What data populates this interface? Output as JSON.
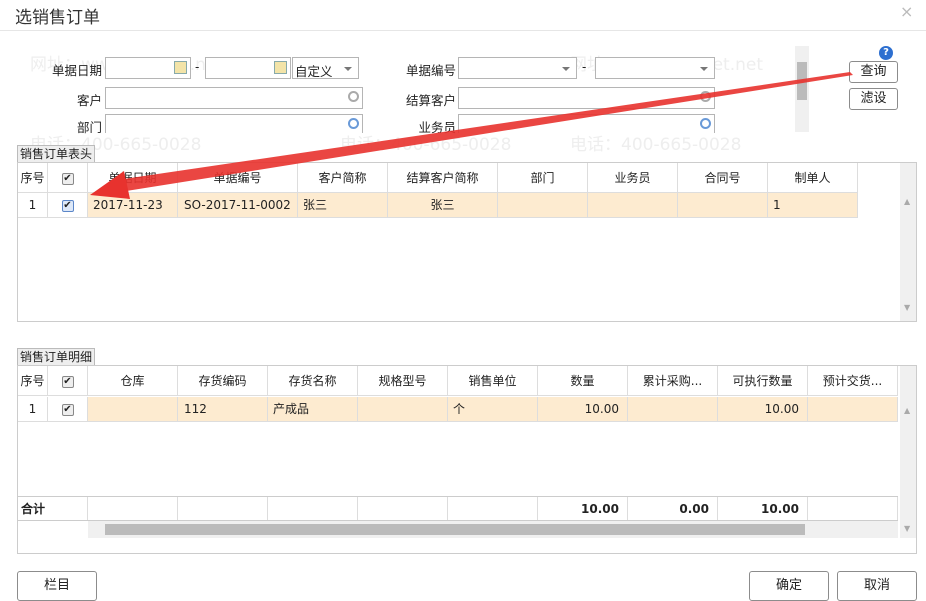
{
  "window": {
    "title": "选销售订单",
    "close": "×"
  },
  "watermark": {
    "phone": "电话：400-665-0028",
    "site": "网址：www.chanjet.net"
  },
  "filters": {
    "doc_date": {
      "label": "单据日期",
      "from": "",
      "to": "",
      "range_sep": "-",
      "preset": "自定义"
    },
    "doc_no": {
      "label": "单据编号",
      "from": "",
      "to": "",
      "range_sep": "-"
    },
    "customer": {
      "label": "客户",
      "value": ""
    },
    "settle_customer": {
      "label": "结算客户",
      "value": ""
    },
    "department": {
      "label": "部门",
      "value": ""
    },
    "salesperson": {
      "label": "业务员",
      "value": ""
    }
  },
  "buttons": {
    "query": "查询",
    "filter_settings": "滤设",
    "columns": "栏目",
    "ok": "确定",
    "cancel": "取消"
  },
  "header_grid": {
    "tab": "销售订单表头",
    "columns": [
      "序号",
      "",
      "单据日期",
      "单据编号",
      "客户简称",
      "结算客户简称",
      "部门",
      "业务员",
      "合同号",
      "制单人"
    ],
    "rows": [
      {
        "seq": "1",
        "checked": true,
        "date": "2017-11-23",
        "no": "SO-2017-11-0002",
        "customer": "张三",
        "settle": "张三",
        "dept": "",
        "sales": "",
        "contract": "",
        "maker": "1"
      }
    ]
  },
  "detail_grid": {
    "tab": "销售订单明细",
    "columns": [
      "序号",
      "",
      "仓库",
      "存货编码",
      "存货名称",
      "规格型号",
      "销售单位",
      "数量",
      "累计采购...",
      "可执行数量",
      "预计交货..."
    ],
    "rows": [
      {
        "seq": "1",
        "checked": true,
        "warehouse": "",
        "code": "112",
        "name": "产成品",
        "spec": "",
        "unit": "个",
        "qty": "10.00",
        "cum_purchase": "",
        "exec_qty": "10.00",
        "delivery": ""
      }
    ],
    "totals": {
      "label": "合计",
      "qty": "10.00",
      "cum_purchase": "0.00",
      "exec_qty": "10.00"
    }
  },
  "colors": {
    "selected_row": "#fdebd0",
    "annotation_arrow": "#e8322e"
  }
}
